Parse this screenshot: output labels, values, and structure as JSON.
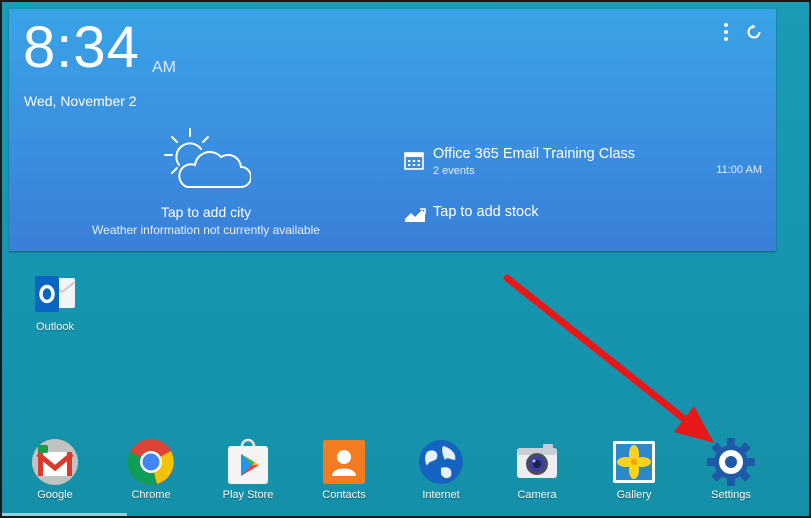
{
  "status": {
    "time_hm": "8:34",
    "ampm": "AM",
    "date": "Wed, November 2"
  },
  "weather": {
    "title": "Tap to add city",
    "subtitle": "Weather information not currently available"
  },
  "calendar": {
    "event_title": "Office 365 Email Training Class",
    "event_sub": "2 events",
    "event_time": "11:00 AM"
  },
  "stock": {
    "label": "Tap to add stock"
  },
  "desktop_apps": [
    {
      "label": "Outlook",
      "icon": "outlook-icon"
    }
  ],
  "dock_apps": [
    {
      "label": "Google",
      "icon": "google-folder-icon"
    },
    {
      "label": "Chrome",
      "icon": "chrome-icon"
    },
    {
      "label": "Play Store",
      "icon": "play-store-icon"
    },
    {
      "label": "Contacts",
      "icon": "contacts-icon"
    },
    {
      "label": "Internet",
      "icon": "internet-icon"
    },
    {
      "label": "Camera",
      "icon": "camera-icon"
    },
    {
      "label": "Gallery",
      "icon": "gallery-icon"
    },
    {
      "label": "Settings",
      "icon": "settings-icon"
    }
  ],
  "colors": {
    "wallpaper": "#1797b1",
    "widget": "#3b8fe0",
    "arrow": "#e81818"
  }
}
